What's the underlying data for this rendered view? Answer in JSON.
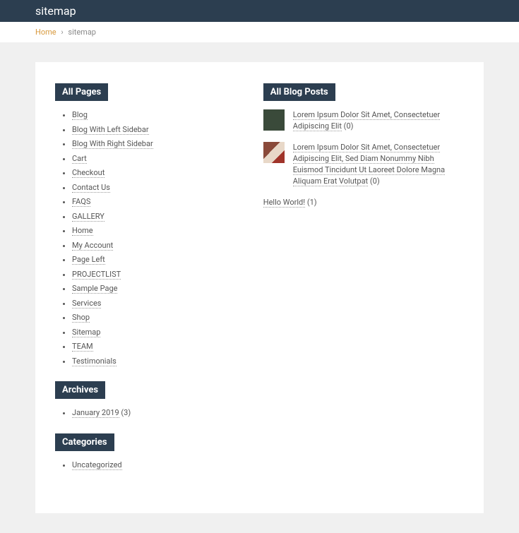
{
  "header": {
    "title": "sitemap"
  },
  "breadcrumb": {
    "home_label": "Home",
    "current": "sitemap"
  },
  "sections": {
    "all_pages_heading": "All Pages",
    "archives_heading": "Archives",
    "categories_heading": "Categories",
    "all_blog_posts_heading": "All Blog Posts"
  },
  "pages": [
    {
      "label": "Blog"
    },
    {
      "label": "Blog With Left Sidebar"
    },
    {
      "label": "Blog With Right Sidebar"
    },
    {
      "label": "Cart"
    },
    {
      "label": "Checkout"
    },
    {
      "label": "Contact Us"
    },
    {
      "label": "FAQS"
    },
    {
      "label": "GALLERY"
    },
    {
      "label": "Home"
    },
    {
      "label": "My Account"
    },
    {
      "label": "Page Left"
    },
    {
      "label": "PROJECTLIST"
    },
    {
      "label": "Sample Page"
    },
    {
      "label": "Services"
    },
    {
      "label": "Shop"
    },
    {
      "label": "Sitemap"
    },
    {
      "label": "TEAM"
    },
    {
      "label": "Testimonials"
    }
  ],
  "archives": [
    {
      "label": "January 2019",
      "count": "(3)"
    }
  ],
  "categories": [
    {
      "label": "Uncategorized"
    }
  ],
  "blog_posts": [
    {
      "title": "Lorem Ipsum Dolor Sit Amet, Consectetuer Adipiscing Elit",
      "count": "(0)",
      "has_thumb": true,
      "thumb_class": "thumb"
    },
    {
      "title": "Lorem Ipsum Dolor Sit Amet, Consectetuer Adipiscing Elit, Sed Diam Nonummy Nibh Euismod Tincidunt Ut Laoreet Dolore Magna Aliquam Erat Volutpat",
      "count": "(0)",
      "has_thumb": true,
      "thumb_class": "thumb thumb2"
    },
    {
      "title": "Hello World!",
      "count": "(1)",
      "has_thumb": false
    }
  ]
}
